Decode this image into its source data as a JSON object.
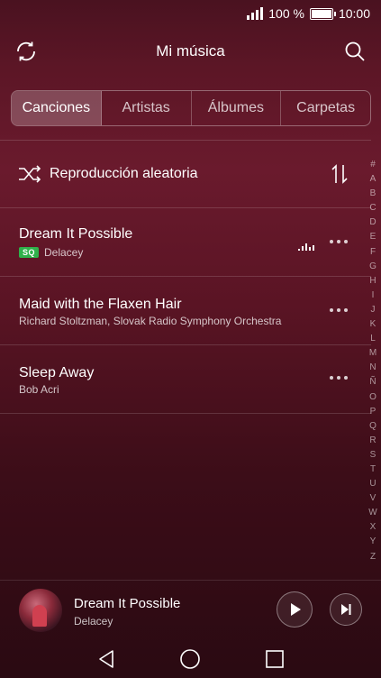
{
  "status_bar": {
    "battery_text": "100 %",
    "time": "10:00",
    "signal_icon": "signal-icon",
    "battery_icon": "battery-icon"
  },
  "header": {
    "title": "Mi música",
    "left_icon": "sync-icon",
    "right_icon": "search-icon"
  },
  "tabs": [
    {
      "label": "Canciones",
      "active": true
    },
    {
      "label": "Artistas",
      "active": false
    },
    {
      "label": "Álbumes",
      "active": false
    },
    {
      "label": "Carpetas",
      "active": false
    }
  ],
  "shuffle": {
    "label": "Reproducción aleatoria",
    "icon": "shuffle-icon",
    "sort_icon": "sort-icon"
  },
  "songs": [
    {
      "title": "Dream It Possible",
      "artist": "Delacey",
      "badge": "SQ",
      "playing": true
    },
    {
      "title": "Maid with the Flaxen Hair",
      "artist": "Richard Stoltzman, Slovak Radio Symphony Orchestra",
      "badge": "",
      "playing": false
    },
    {
      "title": "Sleep Away",
      "artist": "Bob Acri",
      "badge": "",
      "playing": false
    }
  ],
  "alphabet_index": [
    "#",
    "A",
    "B",
    "C",
    "D",
    "E",
    "F",
    "G",
    "H",
    "I",
    "J",
    "K",
    "L",
    "M",
    "N",
    "Ñ",
    "O",
    "P",
    "Q",
    "R",
    "S",
    "T",
    "U",
    "V",
    "W",
    "X",
    "Y",
    "Z"
  ],
  "now_playing": {
    "title": "Dream It Possible",
    "artist": "Delacey",
    "play_icon": "play-icon",
    "next_icon": "skip-next-icon"
  },
  "colors": {
    "background_top": "#4a1220",
    "background_bottom": "#2a0a12",
    "sq_badge": "#2fb14b"
  }
}
